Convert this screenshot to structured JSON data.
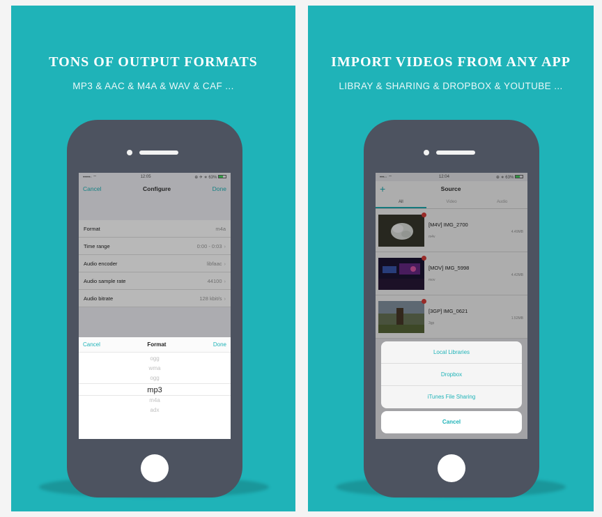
{
  "colors": {
    "accent": "#1fb3b8",
    "phone_body": "#4d5360",
    "badge_red": "#e0403c"
  },
  "left_panel": {
    "headline": "TONS OF OUTPUT FORMATS",
    "subline": "MP3 & AAC & M4A & WAV & CAF ...",
    "status": {
      "carrier": "•••••◦ ⌔",
      "time": "12:05",
      "battery": "⊕ ✈ ∗ 63%"
    },
    "nav": {
      "cancel": "Cancel",
      "title": "Configure",
      "done": "Done"
    },
    "config_rows": [
      {
        "label": "Format",
        "value": "m4a"
      },
      {
        "label": "Time range",
        "value": "0:00 - 0:03"
      },
      {
        "label": "Audio encoder",
        "value": "libfaac"
      },
      {
        "label": "Audio sample rate",
        "value": "44100"
      },
      {
        "label": "Audio bitrate",
        "value": "128 kbit/s"
      }
    ],
    "picker": {
      "cancel": "Cancel",
      "title": "Format",
      "done": "Done",
      "options": [
        "ogg",
        "wma",
        "ogg",
        "mp3",
        "m4a",
        "adx"
      ],
      "selected": "mp3"
    }
  },
  "right_panel": {
    "headline": "IMPORT VIDEOS FROM ANY APP",
    "subline": "LIBRAY & SHARING & DROPBOX & YOUTUBE ...",
    "status": {
      "carrier": "•••◦◦ ⌔",
      "time": "12:04",
      "battery": "⊕ ∗ 63%"
    },
    "nav": {
      "title": "Source"
    },
    "tabs": [
      "All",
      "Video",
      "Audio"
    ],
    "media": [
      {
        "title": "[M4V] IMG_2700",
        "type": "m4v",
        "size": "4.49MB"
      },
      {
        "title": "[MOV] IMG_5998",
        "type": "mov",
        "size": "4.42MB"
      },
      {
        "title": "[3GP] IMG_0621",
        "type": "3gp",
        "size": "1.52MB"
      }
    ],
    "sheet": {
      "items": [
        "Local Libraries",
        "Dropbox",
        "iTunes File Sharing"
      ],
      "cancel": "Cancel"
    }
  }
}
